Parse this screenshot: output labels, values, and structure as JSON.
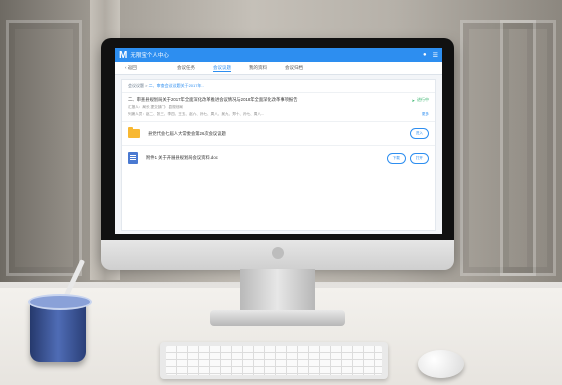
{
  "app": {
    "logo": "M",
    "title": "无限宝个人中心",
    "top_icons": [
      "user-icon",
      "menu-icon"
    ]
  },
  "nav": {
    "back_label": "返回",
    "tabs": [
      "会议任务",
      "会议议题",
      "我的资料",
      "会议归档"
    ],
    "active_index": 1
  },
  "content": {
    "breadcrumb_prefix": "会议议题 >",
    "breadcrumb_link": "二、审查会议议题关于2017年..",
    "notice_title": "二、审查县规划局关于2017年全面深化改革推进会议情况与2018年全面深化改革事项报告",
    "status": "进行中",
    "meta": "汇报人：局长    提交部门：县规划局",
    "receivers": "列席人员：赵二、张三、李四、王五、赵六、孙七、周八、吴九、郑十、孙七、周八...",
    "more": "更多",
    "files": [
      {
        "icon": "folder-icon",
        "name": "县党代会七届人大常委会第26次会议议题",
        "actions": [
          "进入"
        ]
      },
      {
        "icon": "word-doc-icon",
        "name": "附件1 关于开展县规划局会议资料.doc",
        "actions": [
          "下载",
          "打开"
        ]
      }
    ]
  }
}
